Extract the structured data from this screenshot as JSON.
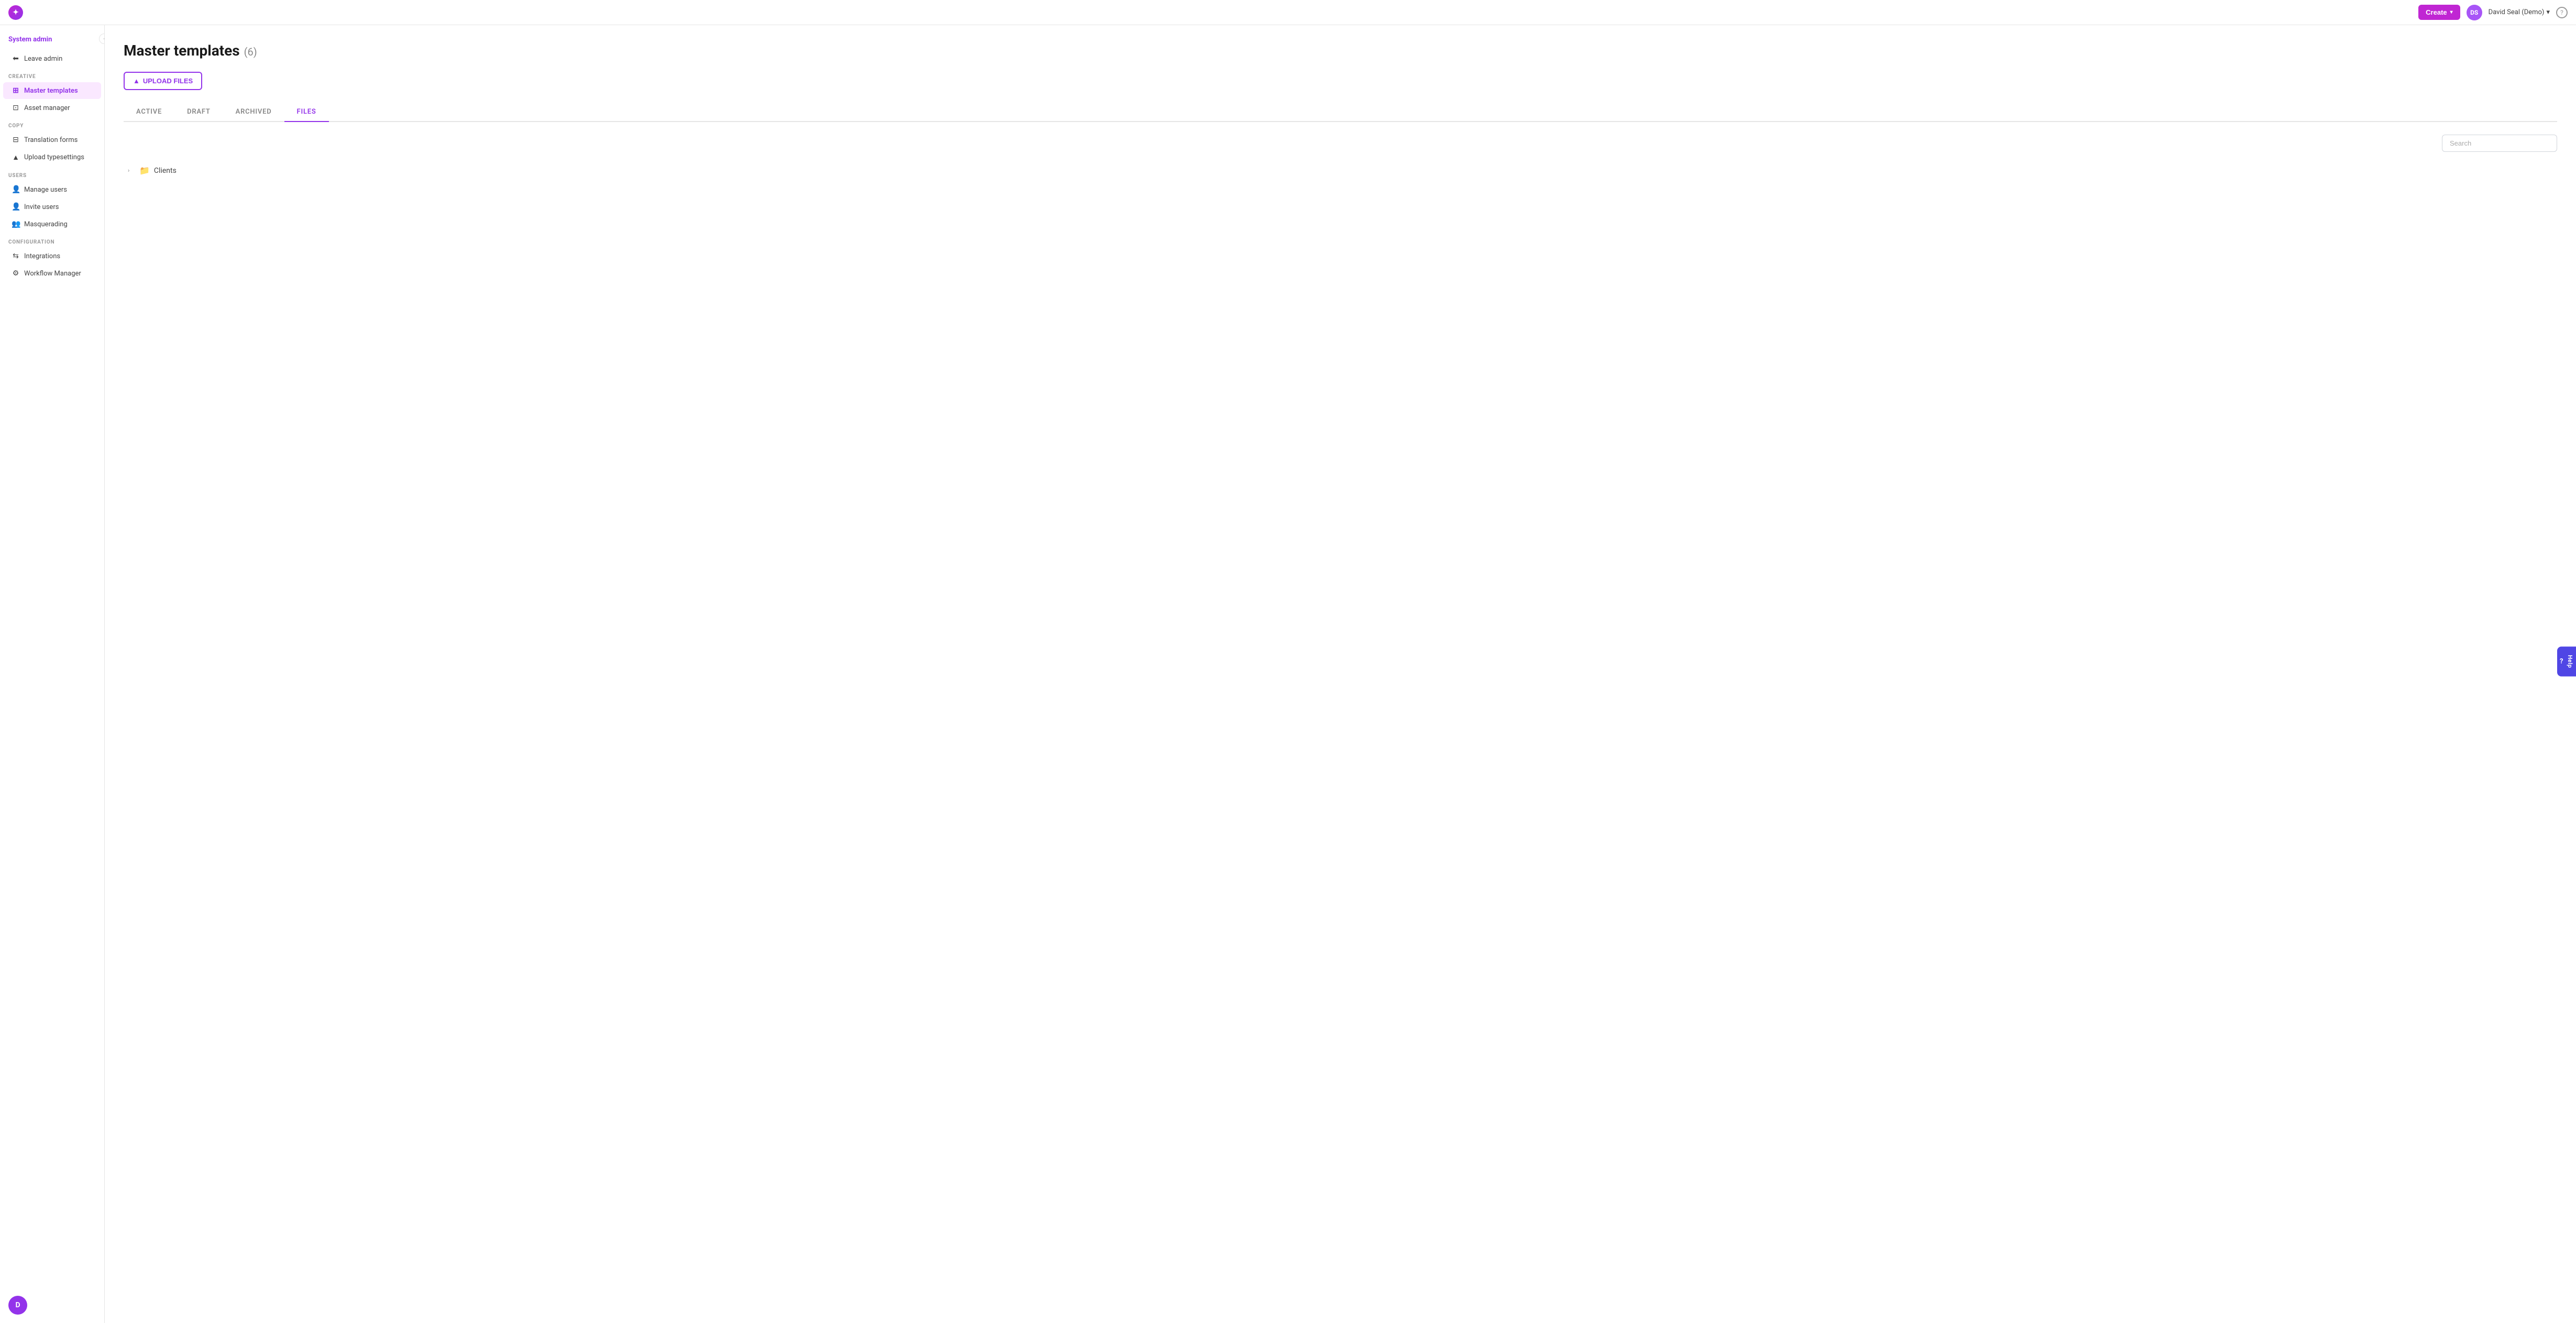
{
  "app": {
    "logo_text": "✦"
  },
  "topnav": {
    "create_label": "Create",
    "chevron": "▾",
    "user_initials": "DS",
    "user_name": "David Seal (Demo)",
    "user_chevron": "▾",
    "help_label": "?"
  },
  "sidebar": {
    "system_admin_label": "System admin",
    "leave_admin_label": "Leave admin",
    "sections": [
      {
        "id": "creative",
        "label": "Creative",
        "items": [
          {
            "id": "master-templates",
            "label": "Master templates",
            "icon": "⊞",
            "active": true
          },
          {
            "id": "asset-manager",
            "label": "Asset manager",
            "icon": "⊡",
            "active": false
          }
        ]
      },
      {
        "id": "copy",
        "label": "Copy",
        "items": [
          {
            "id": "translation-forms",
            "label": "Translation forms",
            "icon": "⊟",
            "active": false
          },
          {
            "id": "upload-typesettings",
            "label": "Upload typesettings",
            "icon": "▲",
            "active": false
          }
        ]
      },
      {
        "id": "users",
        "label": "Users",
        "items": [
          {
            "id": "manage-users",
            "label": "Manage users",
            "icon": "👤",
            "active": false
          },
          {
            "id": "invite-users",
            "label": "Invite users",
            "icon": "👤",
            "active": false
          },
          {
            "id": "masquerading",
            "label": "Masquerading",
            "icon": "👥",
            "active": false
          }
        ]
      },
      {
        "id": "configuration",
        "label": "Configuration",
        "items": [
          {
            "id": "integrations",
            "label": "Integrations",
            "icon": "⇆",
            "active": false
          },
          {
            "id": "workflow-manager",
            "label": "Workflow Manager",
            "icon": "⚙",
            "active": false
          }
        ]
      }
    ]
  },
  "main": {
    "page_title": "Master templates",
    "page_count": "(6)",
    "upload_btn_label": "UPLOAD FILES",
    "tabs": [
      {
        "id": "active",
        "label": "ACTIVE",
        "active": false
      },
      {
        "id": "draft",
        "label": "DRAFT",
        "active": false
      },
      {
        "id": "archived",
        "label": "ARCHIVED",
        "active": false
      },
      {
        "id": "files",
        "label": "FILES",
        "active": true
      }
    ],
    "search_placeholder": "Search",
    "file_tree": [
      {
        "id": "clients",
        "name": "Clients",
        "type": "folder"
      }
    ]
  },
  "help_btn": {
    "label": "Help"
  },
  "bottom_avatar": {
    "initials": "D"
  }
}
